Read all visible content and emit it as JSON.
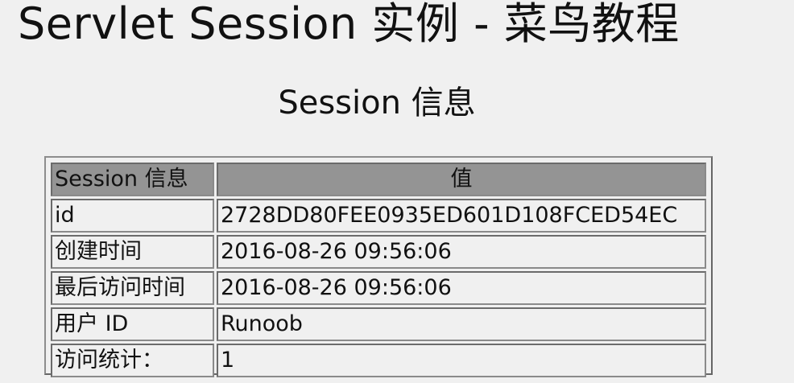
{
  "page": {
    "title": "Servlet Session 实例 - 菜鸟教程",
    "heading": "Session 信息"
  },
  "table": {
    "headers": {
      "name": "Session 信息",
      "value": "值"
    },
    "rows": [
      {
        "name": "id",
        "value": "2728DD80FEE0935ED601D108FCED54EC"
      },
      {
        "name": "创建时间",
        "value": "2016-08-26 09:56:06"
      },
      {
        "name": "最后访问时间",
        "value": "2016-08-26 09:56:06"
      },
      {
        "name": "用户 ID",
        "value": "Runoob"
      },
      {
        "name": "访问统计：",
        "value": "1"
      }
    ]
  }
}
